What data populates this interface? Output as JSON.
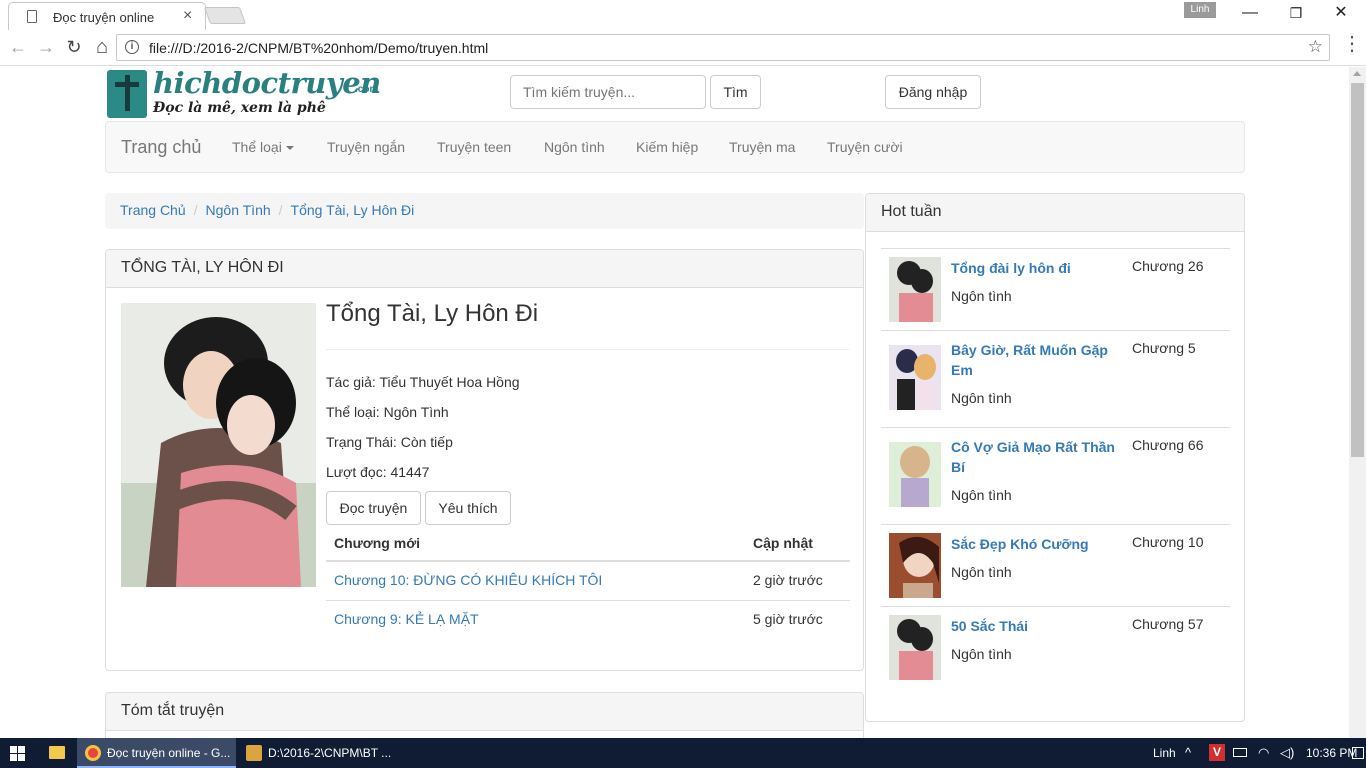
{
  "browser": {
    "tab_title": "Đọc truyện online",
    "tab_close": "×",
    "user_badge": "Linh",
    "url": "file:///D:/2016-2/CNPM/BT%20nhom/Demo/truyen.html",
    "info_glyph": "i",
    "star_glyph": "☆",
    "minimize_glyph": "—",
    "restore_glyph": "❐",
    "close_glyph": "✕",
    "back_glyph": "←",
    "forward_glyph": "→",
    "reload_glyph": "↻",
    "home_glyph": "⌂",
    "menu_glyph": "⋮"
  },
  "header": {
    "logo_text": "hichdoctruyen",
    "logo_domain": ".com",
    "logo_slogan": "Đọc là mê, xem là phê",
    "search_placeholder": "Tìm kiếm truyện...",
    "search_button": "Tìm",
    "login_button": "Đăng nhập"
  },
  "navbar": {
    "brand": "Trang chủ",
    "items": [
      "Thể loại",
      "Truyện ngắn",
      "Truyện teen",
      "Ngôn tình",
      "Kiếm hiệp",
      "Truyện ma",
      "Truyện cười"
    ]
  },
  "breadcrumb": [
    "Trang Chủ",
    "Ngôn Tình",
    "Tổng Tài, Ly Hôn Đi"
  ],
  "breadcrumb_sep": "/",
  "story": {
    "panel_heading": "TỔNG TÀI, LY HÔN ĐI",
    "title": "Tổng Tài, Ly Hôn Đi",
    "author_label": "Tác giả:",
    "author": "Tiểu Thuyết Hoa Hồng",
    "genre_label": "Thể loại:",
    "genre": "Ngôn Tình",
    "status_label": "Trạng Thái:",
    "status": "Còn tiếp",
    "views_label": "Lượt đọc:",
    "views": "41447",
    "read_button": "Đọc truyện",
    "fav_button": "Yêu thích",
    "table_headers": [
      "Chương mới",
      "Cập nhật"
    ],
    "chapters": [
      {
        "title": "Chương 10: ĐỪNG CÓ KHIÊU KHÍCH TÔI",
        "updated": "2 giờ trước"
      },
      {
        "title": "Chương 9: KẺ LẠ MẶT",
        "updated": "5 giờ trước"
      }
    ]
  },
  "summary": {
    "heading": "Tóm tắt truyện"
  },
  "hot": {
    "heading": "Hot tuần",
    "items": [
      {
        "name": "Tổng đài ly hôn đi",
        "chapter": "Chương 26",
        "genre": "Ngôn tình"
      },
      {
        "name": "Bây Giờ, Rất Muốn Gặp Em",
        "chapter": "Chương 5",
        "genre": "Ngôn tình"
      },
      {
        "name": "Cô Vợ Giả Mạo Rất Thần Bí",
        "chapter": "Chương 66",
        "genre": "Ngôn tình"
      },
      {
        "name": "Sắc Đẹp Khó Cưỡng",
        "chapter": "Chương 10",
        "genre": "Ngôn tình"
      },
      {
        "name": "50 Sắc Thái",
        "chapter": "Chương 57",
        "genre": "Ngôn tình"
      }
    ]
  },
  "taskbar": {
    "task1": "Đọc truyện online - G...",
    "task2": "D:\\2016-2\\CNPM\\BT ...",
    "user": "Linh",
    "time": "10:36 PM"
  }
}
